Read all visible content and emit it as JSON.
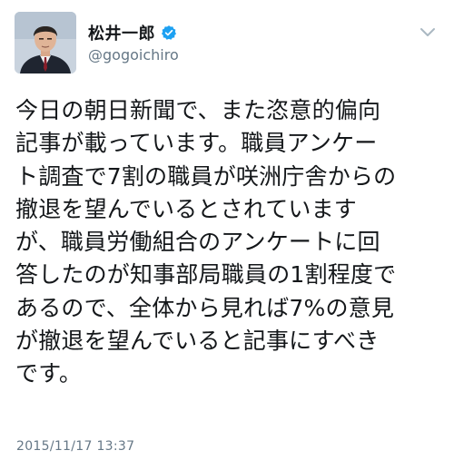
{
  "user": {
    "display_name": "松井一郎",
    "handle": "@gogoichiro",
    "verified_icon": "verified-badge-icon"
  },
  "tweet": {
    "text": "今日の朝日新聞で、また恣意的偏向\n記事が載っています。職員アンケー\nト調査で7割の職員が咲洲庁舎からの\n撤退を望んでいるとされています\nが、職員労働組合のアンケートに回\n答したのが知事部局職員の1割程度で\nあるので、全体から見れば7%の意見\nが撤退を望んでいると記事にすべき\nです。",
    "timestamp": "2015/11/17 13:37"
  },
  "icons": {
    "menu": "chevron-down-icon"
  },
  "colors": {
    "verified_blue": "#1da1f2",
    "secondary_text": "#657786",
    "primary_text": "#14171a"
  }
}
